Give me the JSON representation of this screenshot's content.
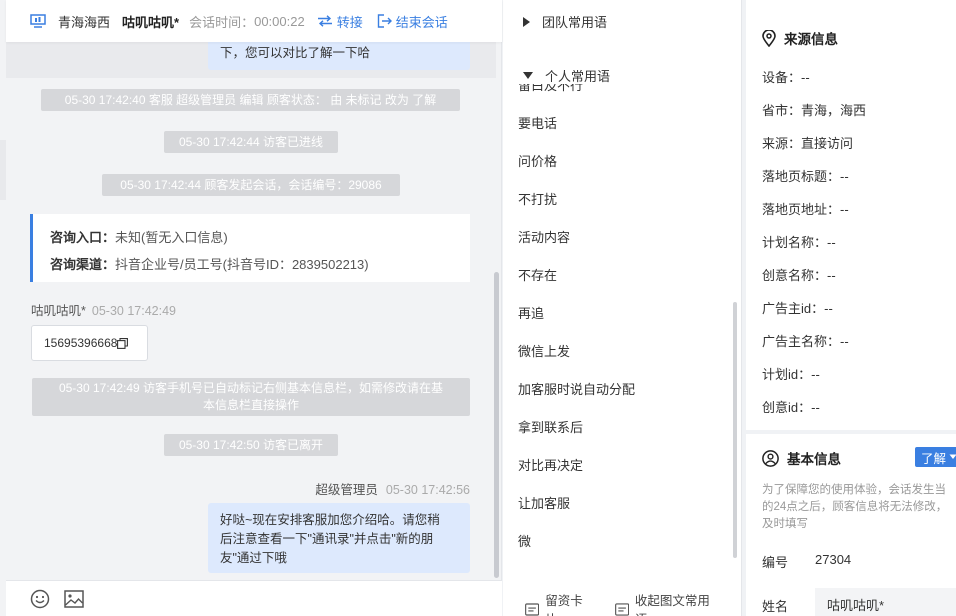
{
  "header": {
    "location": "青海海西",
    "visitor_name": "咕叽咕叽*",
    "session_time_label": "会话时间：",
    "session_time": "00:00:22",
    "transfer_label": "转接",
    "end_label": "结束会话"
  },
  "messages": {
    "prev_agent_text": "下，您可以对比了解一下哈",
    "sys_status": "05-30 17:42:40 客服 超级管理员 编辑 顾客状态： 由 未标记 改为 了解",
    "sys_enter": "05-30 17:42:44 访客已进线",
    "sys_session": "05-30 17:42:44 顾客发起会话，会话编号：29086",
    "entry_label": "咨询入口：",
    "entry_value": "未知(暂无入口信息)",
    "channel_label": "咨询渠道：",
    "channel_value": "抖音企业号/员工号(抖音号ID：2839502213)",
    "visitor_name": "咕叽咕叽*",
    "visitor_time": "05-30 17:42:49",
    "visitor_phone": "15695396668",
    "sys_phone_line1": "05-30 17:42:49 访客手机号已自动标记右侧基本信息栏，如需修改请在基",
    "sys_phone_line2": "本信息栏直接操作",
    "sys_leave": "05-30 17:42:50 访客已离开",
    "agent_name": "超级管理员",
    "agent_time": "05-30 17:42:56",
    "agent_line1": "好哒~现在安排客服加您介绍哈。请您稍",
    "agent_line2": "后注意查看一下\"通讯录\"并点击\"新的朋",
    "agent_line3": "友\"通过下哦"
  },
  "footer_icons": [
    "emoji-icon",
    "image-icon"
  ],
  "quick_replies": {
    "team_group": "团队常用语",
    "personal_group": "个人常用语",
    "partial_item": "留白及不行",
    "items": [
      "要电话",
      "问价格",
      "不打扰",
      "活动内容",
      "不存在",
      "再追",
      "微信上发",
      "加客服时说自动分配",
      "拿到联系后",
      "对比再决定",
      "让加客服",
      "微"
    ],
    "footer_card": "留资卡片",
    "footer_collect": "收起图文常用语"
  },
  "source_info": {
    "title": "来源信息",
    "fields": [
      "设备：--",
      "省市：青海，海西",
      "来源：直接访问",
      "落地页标题：--",
      "落地页地址：--",
      "计划名称：--",
      "创意名称：--",
      "广告主id：--",
      "广告主名称：--",
      "计划id：--",
      "创意id：--"
    ]
  },
  "basic_info": {
    "title": "基本信息",
    "status_button": "了解",
    "notice_line1": "为了保障您的使用体验，会话发生当",
    "notice_line2": "的24点之后，顾客信息将无法修改，",
    "notice_line3": "及时填写",
    "id_label": "编号",
    "id_value": "27304",
    "name_label": "姓名",
    "name_value": "咕叽咕叽*"
  },
  "colors": {
    "accent": "#3a7fe1",
    "agent_bubble": "#dde9fd",
    "system_pill": "#d6d7da"
  }
}
